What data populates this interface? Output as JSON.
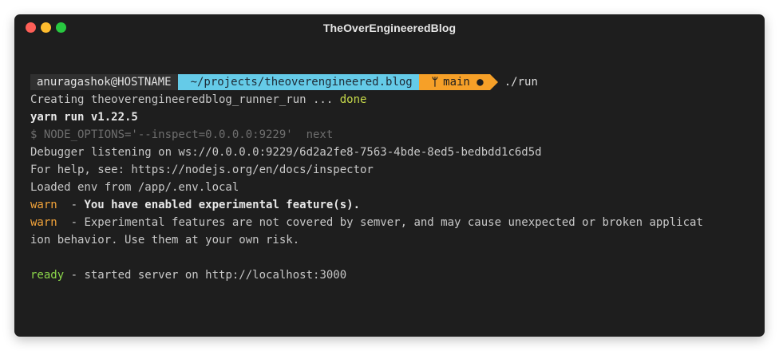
{
  "window": {
    "title": "TheOverEngineeredBlog"
  },
  "prompt": {
    "user": "anuragashok@HOSTNAME",
    "path": "~/projects/theoverengineered.blog",
    "branch_icon": "ᛘ",
    "branch": "main",
    "dirty_marker": "●",
    "command": "./run"
  },
  "output": {
    "l1_text": "Creating theoverengineeredblog_runner_run ... ",
    "l1_status": "done",
    "l2": "yarn run v1.22.5",
    "l3": "$ NODE_OPTIONS='--inspect=0.0.0.0:9229'  next",
    "l4": "Debugger listening on ws://0.0.0.0:9229/6d2a2fe8-7563-4bde-8ed5-bedbdd1c6d5d",
    "l5": "For help, see: https://nodejs.org/en/docs/inspector",
    "l6": "Loaded env from /app/.env.local",
    "warn_label": "warn",
    "l7_sep": "  - ",
    "l7_msg": "You have enabled experimental feature(s).",
    "l8_sep": "  - ",
    "l8_msg": "Experimental features are not covered by semver, and may cause unexpected or broken applicat",
    "l9": "ion behavior. Use them at your own risk.",
    "ready_label": "ready",
    "l10_msg": " - started server on http://localhost:3000"
  },
  "colors": {
    "background": "#1e1e1e",
    "path_segment": "#65cbe8",
    "branch_segment": "#f6a028",
    "warn": "#f2a33a",
    "ready": "#8bd64a",
    "done": "#c6d94a"
  }
}
